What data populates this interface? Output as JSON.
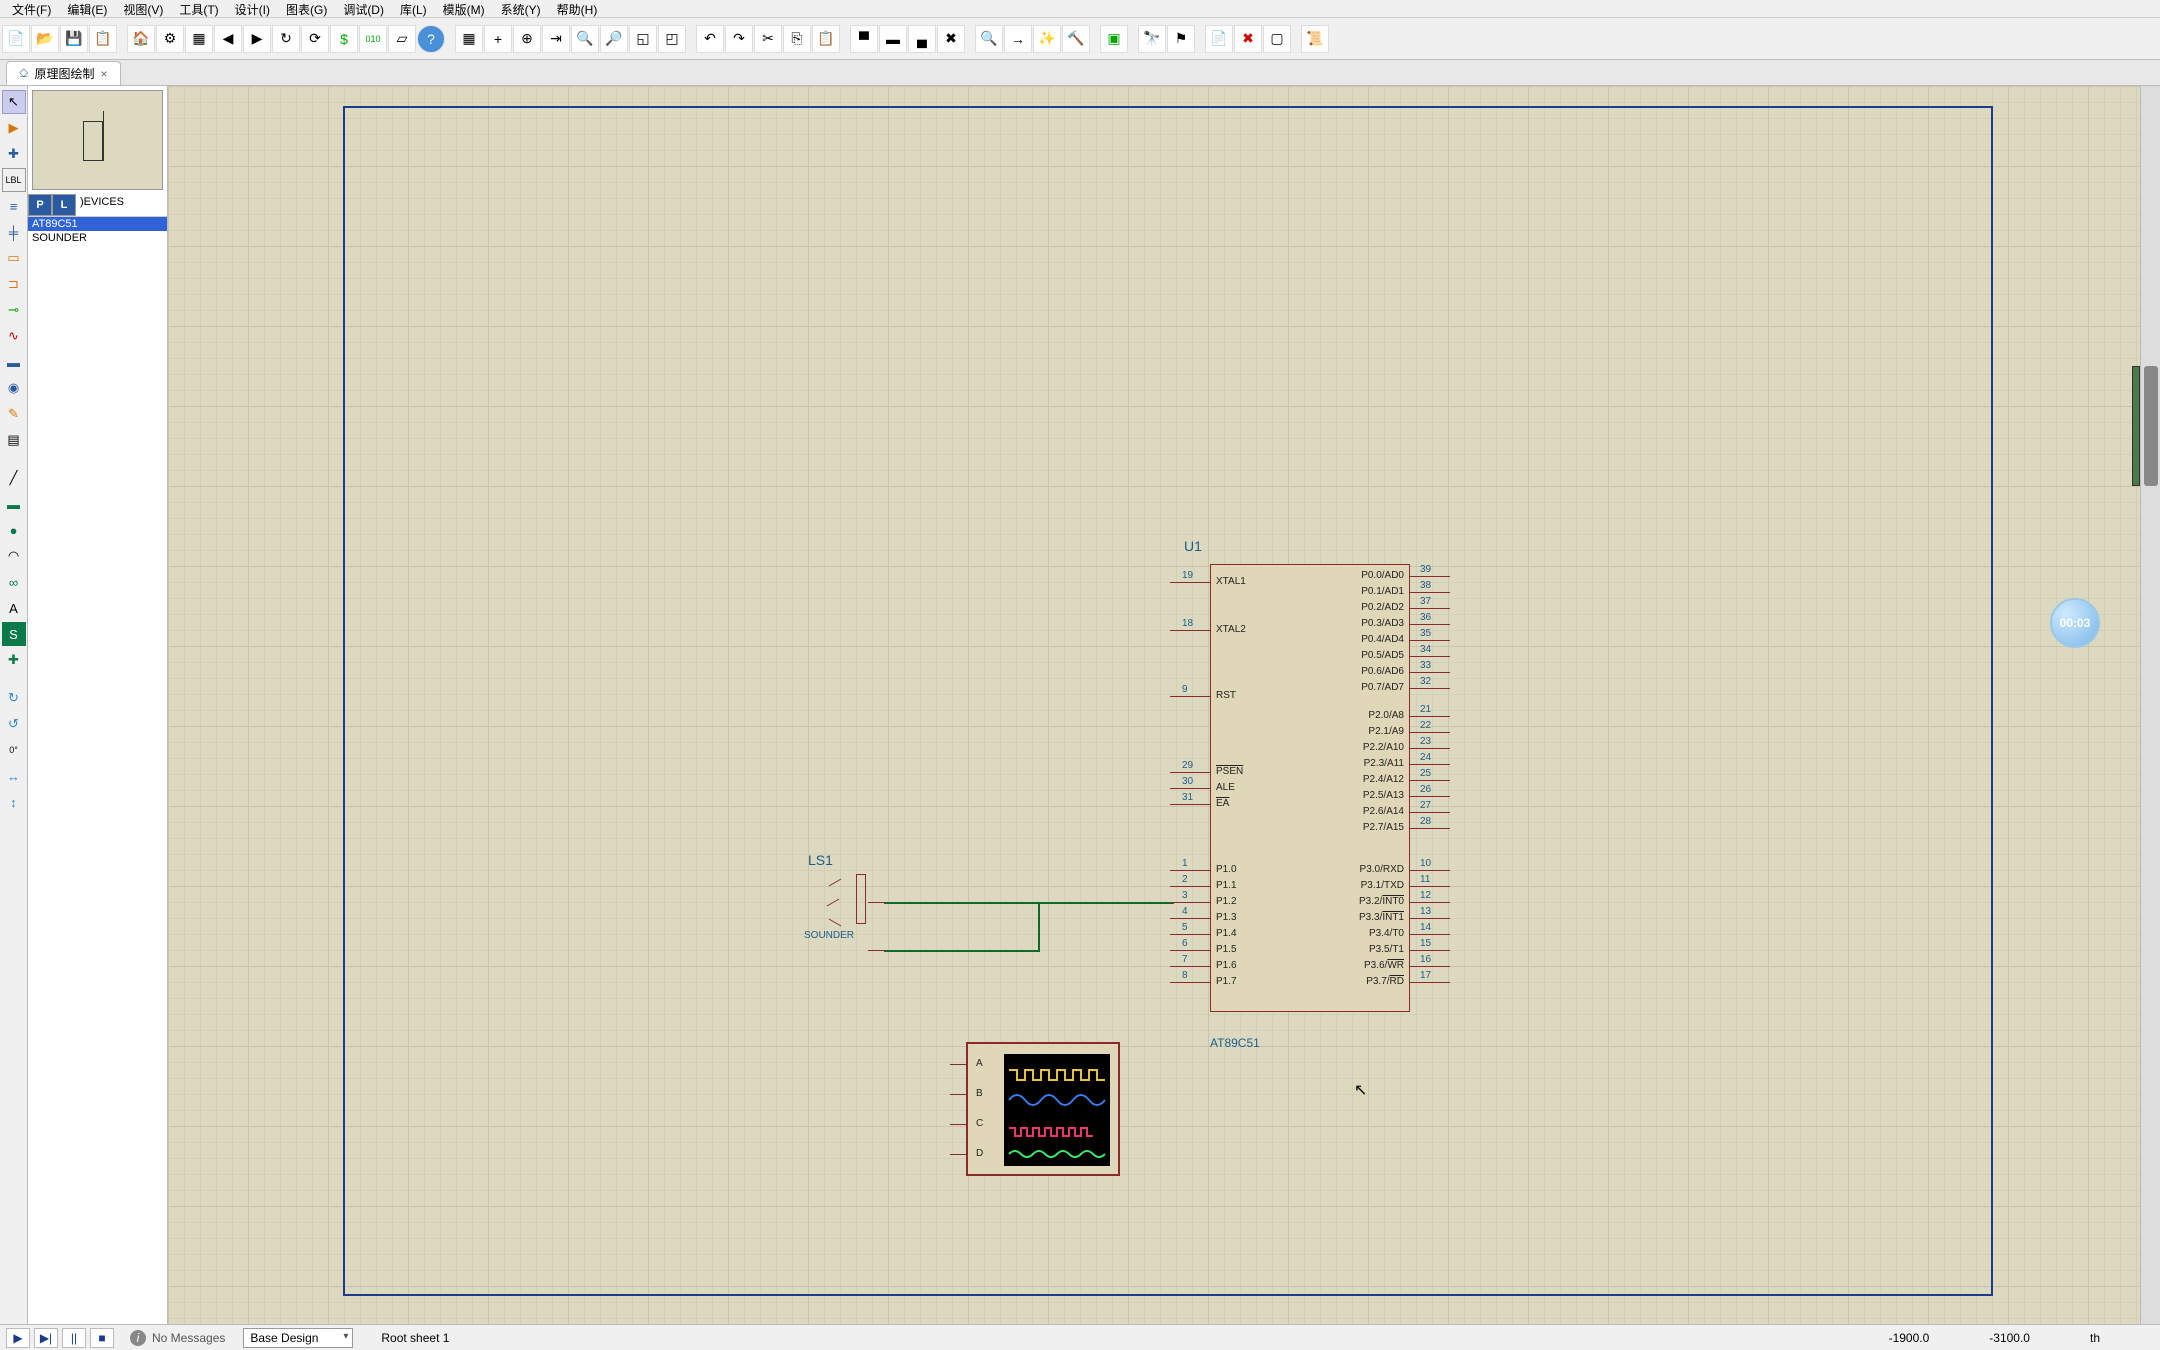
{
  "menu": {
    "file": "文件(F)",
    "edit": "编辑(E)",
    "view": "视图(V)",
    "tools": "工具(T)",
    "design": "设计(I)",
    "chart": "图表(G)",
    "debug": "调试(D)",
    "library": "库(L)",
    "template": "模版(M)",
    "system": "系统(Y)",
    "help": "帮助(H)"
  },
  "tab": {
    "title": "原理图绘制",
    "close": "×"
  },
  "filter": {
    "label": ")EVICES"
  },
  "devices": [
    "AT89C51",
    "SOUNDER"
  ],
  "mcu": {
    "ref": "U1",
    "part": "AT89C51",
    "left_pins": [
      {
        "n": "19",
        "name": "XTAL1"
      },
      {
        "n": "18",
        "name": "XTAL2"
      },
      {
        "n": "9",
        "name": "RST"
      },
      {
        "n": "29",
        "name": "PSEN",
        "ol": true
      },
      {
        "n": "30",
        "name": "ALE"
      },
      {
        "n": "31",
        "name": "EA",
        "ol": true
      },
      {
        "n": "1",
        "name": "P1.0"
      },
      {
        "n": "2",
        "name": "P1.1"
      },
      {
        "n": "3",
        "name": "P1.2"
      },
      {
        "n": "4",
        "name": "P1.3"
      },
      {
        "n": "5",
        "name": "P1.4"
      },
      {
        "n": "6",
        "name": "P1.5"
      },
      {
        "n": "7",
        "name": "P1.6"
      },
      {
        "n": "8",
        "name": "P1.7"
      }
    ],
    "right_pins": [
      {
        "n": "39",
        "name": "P0.0/AD0"
      },
      {
        "n": "38",
        "name": "P0.1/AD1"
      },
      {
        "n": "37",
        "name": "P0.2/AD2"
      },
      {
        "n": "36",
        "name": "P0.3/AD3"
      },
      {
        "n": "35",
        "name": "P0.4/AD4"
      },
      {
        "n": "34",
        "name": "P0.5/AD5"
      },
      {
        "n": "33",
        "name": "P0.6/AD6"
      },
      {
        "n": "32",
        "name": "P0.7/AD7"
      },
      {
        "n": "21",
        "name": "P2.0/A8"
      },
      {
        "n": "22",
        "name": "P2.1/A9"
      },
      {
        "n": "23",
        "name": "P2.2/A10"
      },
      {
        "n": "24",
        "name": "P2.3/A11"
      },
      {
        "n": "25",
        "name": "P2.4/A12"
      },
      {
        "n": "26",
        "name": "P2.5/A13"
      },
      {
        "n": "27",
        "name": "P2.6/A14"
      },
      {
        "n": "28",
        "name": "P2.7/A15"
      },
      {
        "n": "10",
        "name": "P3.0/RXD"
      },
      {
        "n": "11",
        "name": "P3.1/TXD"
      },
      {
        "n": "12",
        "name": "P3.2/INT0",
        "olpart": "INT0"
      },
      {
        "n": "13",
        "name": "P3.3/INT1",
        "olpart": "INT1"
      },
      {
        "n": "14",
        "name": "P3.4/T0"
      },
      {
        "n": "15",
        "name": "P3.5/T1"
      },
      {
        "n": "16",
        "name": "P3.6/WR",
        "olpart": "WR"
      },
      {
        "n": "17",
        "name": "P3.7/RD",
        "olpart": "RD"
      }
    ]
  },
  "sounder": {
    "ref": "LS1",
    "name": "SOUNDER"
  },
  "scope": {
    "channels": [
      "A",
      "B",
      "C",
      "D"
    ]
  },
  "status": {
    "no_messages": "No Messages",
    "design_combo": "Base Design",
    "sheet": "Root sheet 1",
    "coord_x": "-1900.0",
    "coord_y": "-3100.0",
    "unit": "th"
  },
  "timer": {
    "value": "00:03"
  },
  "sim": {
    "play": "▶",
    "step": "▶|",
    "pause": "||",
    "stop": "■"
  },
  "picker_p": "P",
  "picker_l": "L"
}
